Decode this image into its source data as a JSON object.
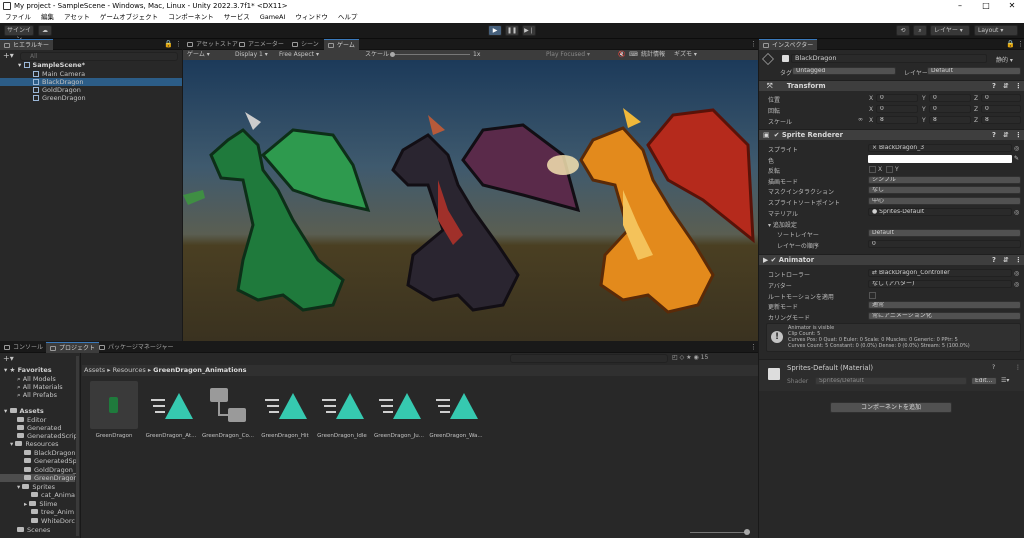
{
  "window": {
    "title": "My project - SampleScene - Windows, Mac, Linux - Unity 2022.3.7f1* <DX11>"
  },
  "menu": [
    "ファイル",
    "編集",
    "アセット",
    "ゲームオブジェクト",
    "コンポーネント",
    "サービス",
    "GameAI",
    "ウィンドウ",
    "ヘルプ"
  ],
  "toolbar": {
    "signin": "サインイン",
    "layers": "レイヤー",
    "layout": "Layout"
  },
  "hierarchy": {
    "tab": "ヒエラルキー",
    "search_placeholder": "All",
    "scene": "SampleScene*",
    "items": [
      "Main Camera",
      "BlackDragon",
      "GoldDragon",
      "GreenDragon"
    ]
  },
  "center_tabs": [
    "アセットストア",
    "アニメーター",
    "シーン",
    "ゲーム"
  ],
  "game_bar": {
    "display": "Display 1",
    "aspect": "Free Aspect",
    "scale_label": "スケール",
    "scale_value": "1x",
    "play_focused": "Play Focused",
    "stats": "統計情報",
    "gizmos": "ギズモ"
  },
  "bottom_tabs": [
    "コンソール",
    "プロジェクト",
    "パッケージマネージャー"
  ],
  "project": {
    "favorites_label": "Favorites",
    "favorites": [
      "All Models",
      "All Materials",
      "All Prefabs"
    ],
    "assets_label": "Assets",
    "tree": [
      "Editor",
      "Generated",
      "GeneratedScrip",
      "Resources",
      "BlackDragon",
      "GeneratedSp",
      "GoldDragon_",
      "GreenDragon",
      "Sprites",
      "cat_Anima",
      "Slime",
      "tree_Anim",
      "WhiteDorc",
      "Scenes"
    ],
    "breadcrumb": [
      "Assets",
      "Resources",
      "GreenDragon_Animations"
    ],
    "item_count": "15",
    "assets": [
      "GreenDragon",
      "GreenDragon_At...",
      "GreenDragon_Co...",
      "GreenDragon_Hit",
      "GreenDragon_Idle",
      "GreenDragon_Ju...",
      "GreenDragon_Wa..."
    ]
  },
  "inspector": {
    "tab": "インスペクター",
    "object_name": "BlackDragon",
    "static_label": "静的",
    "tag_label": "タグ",
    "tag_value": "Untagged",
    "layer_label": "レイヤー",
    "layer_value": "Default",
    "transform": {
      "title": "Transform",
      "rows": [
        {
          "label": "位置",
          "x": "0",
          "y": "0",
          "z": "0"
        },
        {
          "label": "回転",
          "x": "0",
          "y": "0",
          "z": "0"
        },
        {
          "label": "スケール",
          "x": "8",
          "y": "8",
          "z": "8"
        }
      ]
    },
    "sprite_renderer": {
      "title": "Sprite Renderer",
      "sprite_label": "スプライト",
      "sprite_value": "BlackDragon_3",
      "color_label": "色",
      "flip_label": "反転",
      "flip_x": "X",
      "flip_y": "Y",
      "draw_mode_label": "描画モード",
      "draw_mode_value": "シンプル",
      "mask_label": "マスクインタラクション",
      "mask_value": "なし",
      "sort_point_label": "スプライトソートポイント",
      "sort_point_value": "中心",
      "material_label": "マテリアル",
      "material_value": "Sprites-Default",
      "additional_label": "追加設定",
      "sorting_layer_label": "ソートレイヤー",
      "sorting_layer_value": "Default",
      "order_label": "レイヤーの順序",
      "order_value": "0"
    },
    "animator": {
      "title": "Animator",
      "controller_label": "コントローラー",
      "controller_value": "BlackDragon_Controller",
      "avatar_label": "アバター",
      "avatar_value": "なし (アバター)",
      "root_motion_label": "ルートモーションを適用",
      "update_label": "更新モード",
      "update_value": "通常",
      "culling_label": "カリングモード",
      "culling_value": "常にアニメーション化",
      "info": [
        "Animator is visible",
        "Clip Count: 5",
        "Curves Pos: 0 Quat: 0 Euler: 0 Scale: 0 Muscles: 0 Generic: 0 PPtr: 5",
        "Curves Count: 5 Constant: 0 (0.0%) Dense: 0 (0.0%) Stream: 5 (100.0%)"
      ]
    },
    "material": {
      "title": "Sprites-Default (Material)",
      "shader_label": "Shader",
      "shader_value": "Sprites/Default",
      "edit": "Edit..."
    },
    "add_component": "コンポーネントを追加"
  },
  "colors": {
    "accent": "#3a79bb",
    "panel": "#282828",
    "header": "#3e3e3e",
    "play_active": "#46607c"
  }
}
